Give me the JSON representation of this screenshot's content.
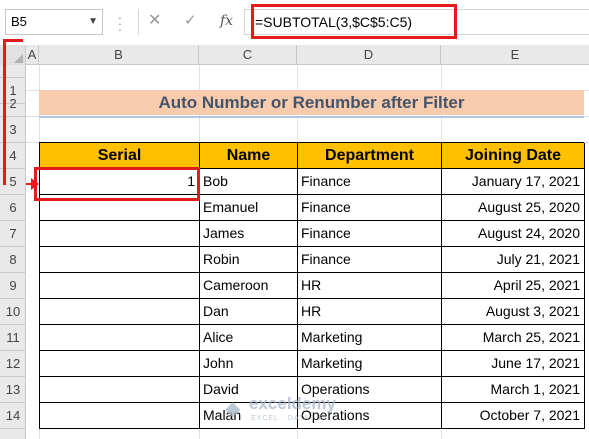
{
  "formula_bar": {
    "name_box": "B5",
    "cancel_icon": "✕",
    "enter_icon": "✓",
    "fx_label": "fx",
    "formula": "=SUBTOTAL(3,$C$5:C5)"
  },
  "columns": [
    "A",
    "B",
    "C",
    "D",
    "E"
  ],
  "rows": [
    "1",
    "2",
    "3",
    "4",
    "5",
    "6",
    "7",
    "8",
    "9",
    "10",
    "11",
    "12",
    "13",
    "14"
  ],
  "title": "Auto Number or Renumber after Filter",
  "table": {
    "headers": [
      "Serial",
      "Name",
      "Department",
      "Joining Date"
    ],
    "rows": [
      {
        "serial": "1",
        "name": "Bob",
        "department": "Finance",
        "date": "January 17, 2021"
      },
      {
        "serial": "",
        "name": "Emanuel",
        "department": "Finance",
        "date": "August 25, 2020"
      },
      {
        "serial": "",
        "name": "James",
        "department": "Finance",
        "date": "August 24, 2020"
      },
      {
        "serial": "",
        "name": "Robin",
        "department": "Finance",
        "date": "July 21, 2021"
      },
      {
        "serial": "",
        "name": "Cameroon",
        "department": "HR",
        "date": "April 25, 2021"
      },
      {
        "serial": "",
        "name": "Dan",
        "department": "HR",
        "date": "August 3, 2021"
      },
      {
        "serial": "",
        "name": "Alice",
        "department": "Marketing",
        "date": "March 25, 2021"
      },
      {
        "serial": "",
        "name": "John",
        "department": "Marketing",
        "date": "June 17, 2021"
      },
      {
        "serial": "",
        "name": "David",
        "department": "Operations",
        "date": "March 1, 2021"
      },
      {
        "serial": "",
        "name": "Malan",
        "department": "Operations",
        "date": "October 7, 2021"
      }
    ]
  },
  "watermark": {
    "name": "exceldemy",
    "subtitle": "EXCEL · DATA · BI"
  },
  "colors": {
    "header_fill": "#ffc000",
    "title_fill": "#f8cbad",
    "highlight": "#e31b1b"
  }
}
